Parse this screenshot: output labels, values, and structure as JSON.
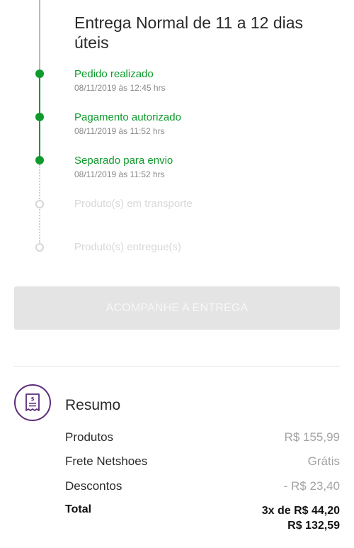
{
  "delivery": {
    "title": "Entrega Normal de 11 a 12 dias úteis"
  },
  "timeline": {
    "steps": [
      {
        "label": "Pedido realizado",
        "time": "08/11/2019 às 12:45 hrs",
        "status": "done"
      },
      {
        "label": "Pagamento autorizado",
        "time": "08/11/2019 às 11:52 hrs",
        "status": "done"
      },
      {
        "label": "Separado para envio",
        "time": "08/11/2019 às 11:52 hrs",
        "status": "done"
      },
      {
        "label": "Produto(s) em transporte",
        "time": "",
        "status": "pending"
      },
      {
        "label": "Produto(s) entregue(s)",
        "time": "",
        "status": "pending"
      }
    ],
    "colors": {
      "done": "#0e9a2c",
      "pending": "#d8d8d8"
    }
  },
  "track_button": {
    "label": "ACOMPANHE A ENTREGA",
    "state": "disabled"
  },
  "summary": {
    "icon": "receipt-icon",
    "icon_color": "#5c2b7c",
    "title": "Resumo",
    "rows": [
      {
        "label": "Produtos",
        "value": "R$ 155,99"
      },
      {
        "label": "Frete Netshoes",
        "value": "Grátis"
      },
      {
        "label": "Descontos",
        "value": "- R$ 23,40"
      }
    ],
    "total": {
      "label": "Total",
      "installments": "3x de R$ 44,20",
      "amount": "R$ 132,59"
    }
  }
}
